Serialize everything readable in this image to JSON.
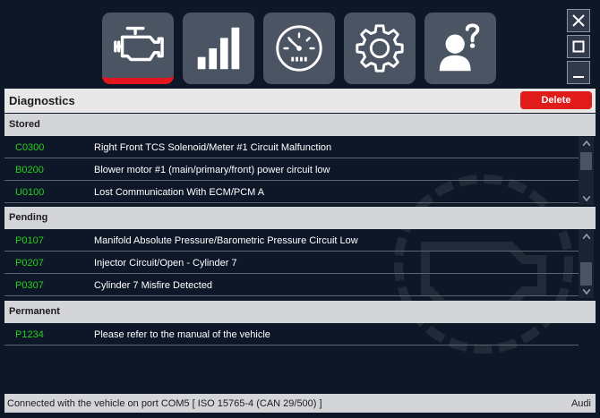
{
  "toolbar": {
    "tabs": [
      {
        "icon": "engine-icon",
        "active": true
      },
      {
        "icon": "signal-bars-icon",
        "active": false
      },
      {
        "icon": "gauge-icon",
        "active": false
      },
      {
        "icon": "gear-icon",
        "active": false
      },
      {
        "icon": "support-person-icon",
        "active": false
      }
    ],
    "window_controls": [
      "close-icon",
      "maximize-icon",
      "minimize-icon"
    ]
  },
  "header": {
    "title": "Diagnostics",
    "delete_label": "Delete"
  },
  "sections": {
    "stored": {
      "label": "Stored",
      "rows": [
        {
          "code": "C0300",
          "description": "Right Front TCS Solenoid/Meter #1 Circuit Malfunction"
        },
        {
          "code": "B0200",
          "description": "Blower motor #1 (main/primary/front) power circuit low"
        },
        {
          "code": "U0100",
          "description": "Lost Communication With ECM/PCM A"
        }
      ]
    },
    "pending": {
      "label": "Pending",
      "rows": [
        {
          "code": "P0107",
          "description": "Manifold Absolute Pressure/Barometric Pressure Circuit Low"
        },
        {
          "code": "P0207",
          "description": "Injector Circuit/Open - Cylinder 7"
        },
        {
          "code": "P0307",
          "description": "Cylinder 7 Misfire Detected"
        }
      ]
    },
    "permanent": {
      "label": "Permanent",
      "rows": [
        {
          "code": "P1234",
          "description": "Please refer to the manual of the vehicle"
        }
      ]
    }
  },
  "status": {
    "connection": "Connected with the vehicle on port COM5  [ ISO 15765-4 (CAN 29/500) ]",
    "brand": "Audi"
  },
  "colors": {
    "background": "#0e1727",
    "button": "#4b5463",
    "accent_red": "#e2161c",
    "code_green": "#26d01c",
    "section_header": "#d3d5d9"
  }
}
